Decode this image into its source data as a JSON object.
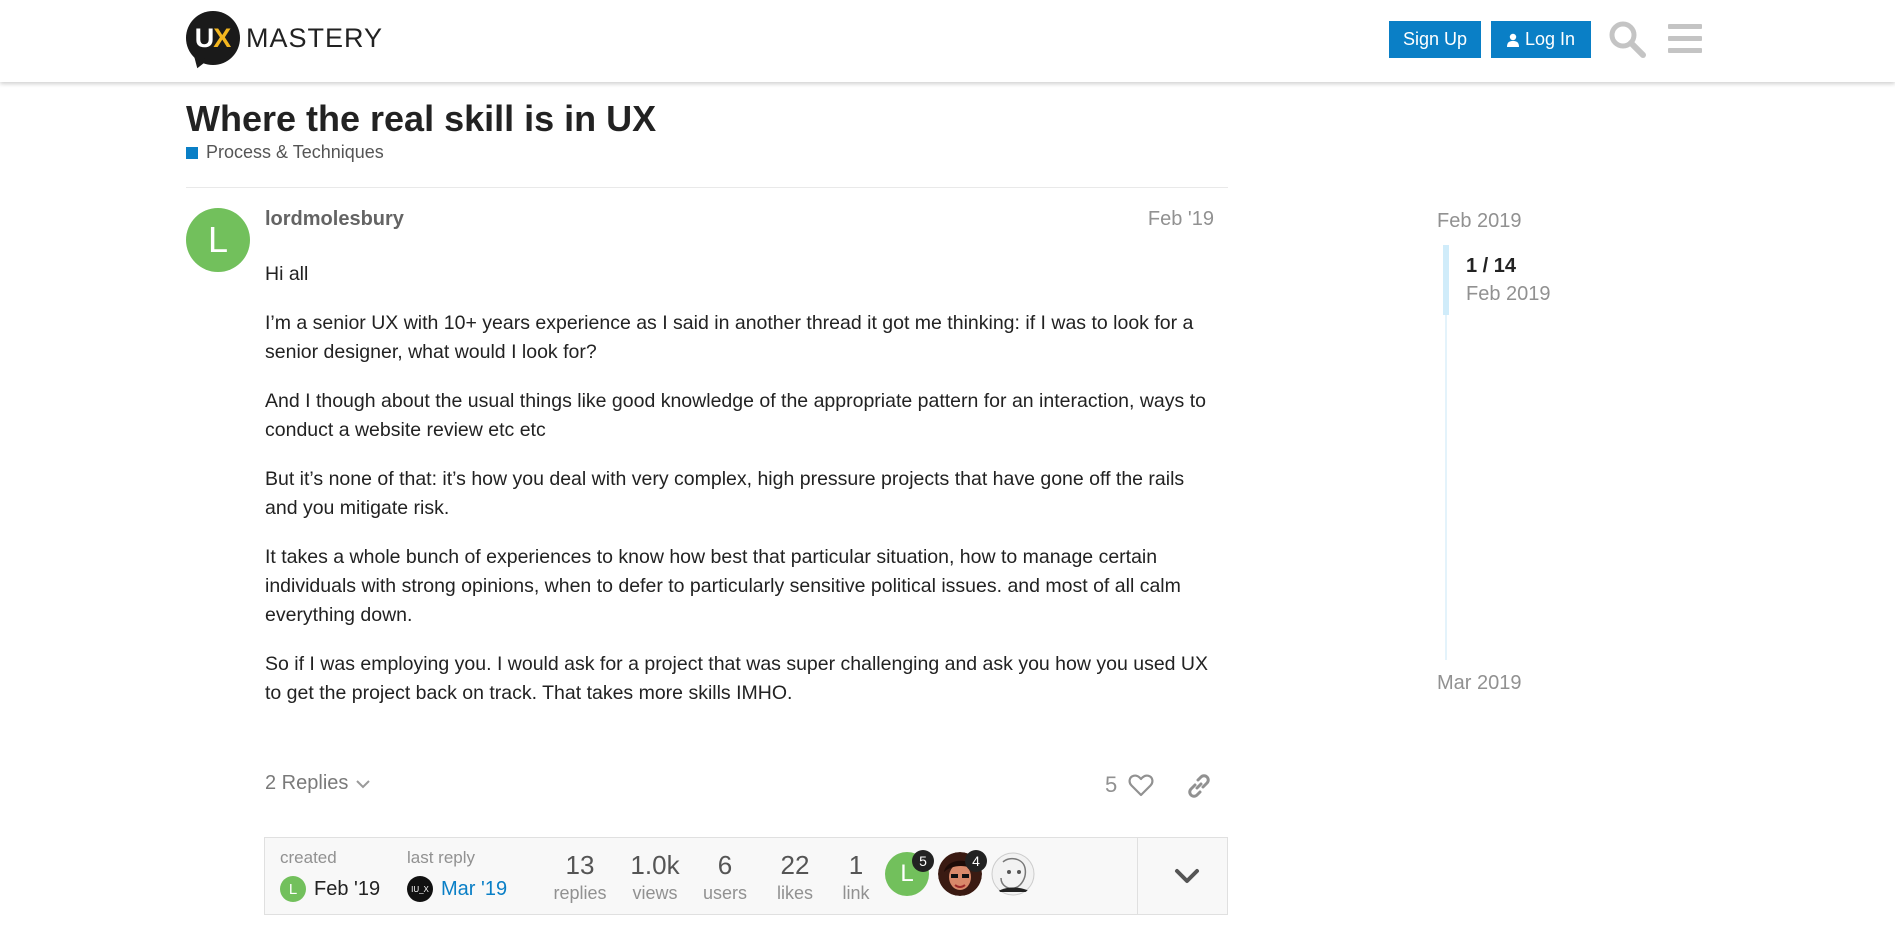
{
  "header": {
    "logo_mark_u": "U",
    "logo_mark_x": "X",
    "logo_text": "MASTERY",
    "signup_label": "Sign Up",
    "login_label": "Log In",
    "icons": [
      "search-icon",
      "hamburger-menu-icon",
      "user-icon"
    ]
  },
  "topic": {
    "title": "Where the real skill is in UX",
    "category": "Process & Techniques",
    "category_color": "#0a7fc6"
  },
  "post": {
    "avatar_letter": "L",
    "avatar_color": "#72c05c",
    "username": "lordmolesbury",
    "date": "Feb '19",
    "paragraphs": [
      "Hi all",
      "I’m a senior UX with 10+ years experience as I said in another thread it got me thinking: if I was to look for a senior designer, what would I look for?",
      "And I though about the usual things like good knowledge of the appropriate pattern for an interaction, ways to conduct a website review etc etc",
      "But it’s none of that: it’s how you deal with very complex, high pressure projects that have gone off the rails and you mitigate risk.",
      "It takes a whole bunch of experiences to know how best that particular situation, how to manage certain individuals with strong opinions, when to defer to particularly sensitive political issues. and most of all calm everything down.",
      "So if I was employing you. I would ask for a project that was super challenging and ask you how you used UX to get the project back on track. That takes more skills IMHO."
    ],
    "replies_label": "2 Replies",
    "like_count": "5"
  },
  "topic_map": {
    "created_label": "created",
    "created_avatar": "L",
    "created_date": "Feb '19",
    "last_reply_label": "last reply",
    "last_reply_avatar": "IU_X",
    "last_reply_date": "Mar '19",
    "stats": [
      {
        "num": "13",
        "label": "replies"
      },
      {
        "num": "1.0k",
        "label": "views"
      },
      {
        "num": "6",
        "label": "users"
      },
      {
        "num": "22",
        "label": "likes"
      },
      {
        "num": "1",
        "label": "link"
      }
    ],
    "participants": [
      {
        "letter": "L",
        "count": "5"
      },
      {
        "letter": "",
        "count": "4"
      },
      {
        "letter": "",
        "count": ""
      }
    ]
  },
  "timeline": {
    "start": "Feb 2019",
    "position": "1 / 14",
    "position_date": "Feb 2019",
    "end": "Mar 2019"
  }
}
